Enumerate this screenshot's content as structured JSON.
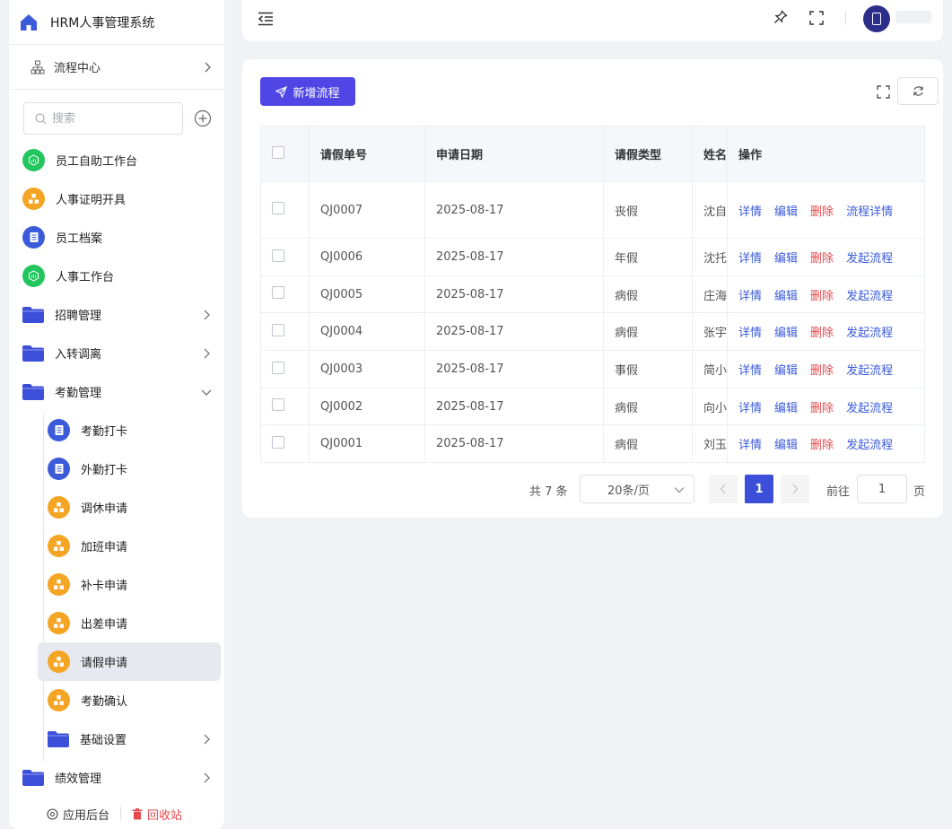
{
  "sidebar": {
    "app_title": "HRM人事管理系统",
    "flow_center": "流程中心",
    "search_placeholder": "搜索",
    "items": [
      {
        "label": "员工自助工作台"
      },
      {
        "label": "人事证明开具"
      },
      {
        "label": "员工档案"
      },
      {
        "label": "人事工作台"
      },
      {
        "label": "招聘管理"
      },
      {
        "label": "入转调离"
      },
      {
        "label": "考勤管理"
      },
      {
        "label": "考勤打卡"
      },
      {
        "label": "外勤打卡"
      },
      {
        "label": "调休申请"
      },
      {
        "label": "加班申请"
      },
      {
        "label": "补卡申请"
      },
      {
        "label": "出差申请"
      },
      {
        "label": "请假申请"
      },
      {
        "label": "考勤确认"
      },
      {
        "label": "基础设置"
      },
      {
        "label": "绩效管理"
      }
    ],
    "footer": {
      "backend": "应用后台",
      "recycle": "回收站"
    }
  },
  "toolbar": {
    "new_label": "新增流程"
  },
  "table": {
    "headers": [
      "请假单号",
      "申请日期",
      "请假类型",
      "姓名",
      "操作"
    ],
    "rows": [
      {
        "id": "QJ0007",
        "date": "2025-08-17",
        "type": "丧假",
        "name": "沈自",
        "ops": [
          "详情",
          "编辑",
          "删除",
          "流程详情"
        ]
      },
      {
        "id": "QJ0006",
        "date": "2025-08-17",
        "type": "年假",
        "name": "沈托",
        "ops": [
          "详情",
          "编辑",
          "删除",
          "发起流程"
        ]
      },
      {
        "id": "QJ0005",
        "date": "2025-08-17",
        "type": "病假",
        "name": "庄海",
        "ops": [
          "详情",
          "编辑",
          "删除",
          "发起流程"
        ]
      },
      {
        "id": "QJ0004",
        "date": "2025-08-17",
        "type": "病假",
        "name": "张宇",
        "ops": [
          "详情",
          "编辑",
          "删除",
          "发起流程"
        ]
      },
      {
        "id": "QJ0003",
        "date": "2025-08-17",
        "type": "事假",
        "name": "简小",
        "ops": [
          "详情",
          "编辑",
          "删除",
          "发起流程"
        ]
      },
      {
        "id": "QJ0002",
        "date": "2025-08-17",
        "type": "病假",
        "name": "向小",
        "ops": [
          "详情",
          "编辑",
          "删除",
          "发起流程"
        ]
      },
      {
        "id": "QJ0001",
        "date": "2025-08-17",
        "type": "病假",
        "name": "刘玉",
        "ops": [
          "详情",
          "编辑",
          "删除",
          "发起流程"
        ]
      }
    ]
  },
  "pagination": {
    "total_text": "共 7 条",
    "page_size": "20条/页",
    "current_page": "1",
    "goto_label": "前往",
    "goto_value": "1",
    "page_unit": "页"
  },
  "colors": {
    "accent": "#4f46e5",
    "danger": "#e5484d",
    "link": "#3b5bdb"
  }
}
